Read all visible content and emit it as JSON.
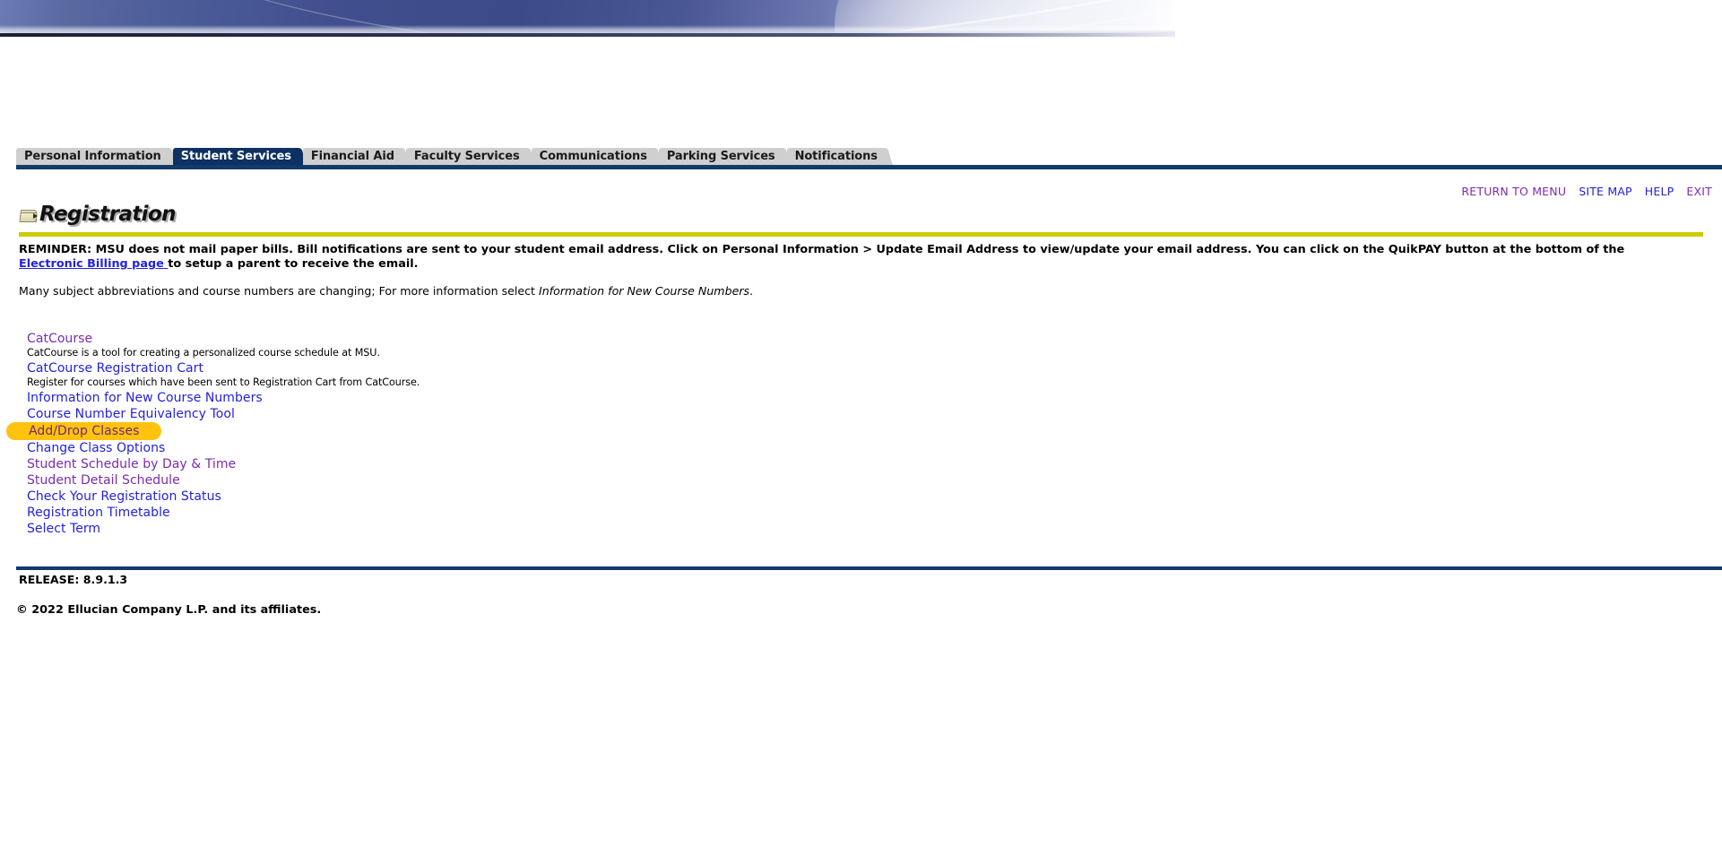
{
  "banner": {
    "alt": "university-banner-graphic"
  },
  "tabs": [
    {
      "label": "Personal Information",
      "active": false
    },
    {
      "label": "Student Services",
      "active": true
    },
    {
      "label": "Financial Aid",
      "active": false
    },
    {
      "label": "Faculty Services",
      "active": false
    },
    {
      "label": "Communications",
      "active": false
    },
    {
      "label": "Parking Services",
      "active": false
    },
    {
      "label": "Notifications",
      "active": false
    }
  ],
  "top_links": [
    {
      "label": "RETURN TO MENU",
      "state": "visited"
    },
    {
      "label": "SITE MAP",
      "state": "unvisited"
    },
    {
      "label": "HELP",
      "state": "unvisited"
    },
    {
      "label": "EXIT",
      "state": "visited"
    }
  ],
  "page": {
    "title": "Registration",
    "title_icon": "folder-icon"
  },
  "reminder": {
    "part1": "REMINDER: MSU does not mail paper bills. Bill notifications are sent to your student email address. Click on Personal Information > Update Email Address to view/update your email address. You can click on the QuikPAY button at the bottom of the ",
    "link": "Electronic Billing page ",
    "part2": "to setup a parent to receive the email."
  },
  "note": {
    "text_before": "Many subject abbreviations and course numbers are changing; For more information select ",
    "italic": "Information for New Course Numbers",
    "text_after": "."
  },
  "menu": {
    "items": [
      {
        "label": "CatCourse",
        "state": "visited",
        "desc": "CatCourse is a tool for creating a personalized course schedule at MSU.",
        "highlighted": false
      },
      {
        "label": "CatCourse Registration Cart",
        "state": "unvisited",
        "desc": "Register for courses which have been sent to Registration Cart from CatCourse.",
        "highlighted": false
      },
      {
        "label": "Information for New Course Numbers",
        "state": "unvisited",
        "desc": "",
        "highlighted": false
      },
      {
        "label": "Course Number Equivalency Tool",
        "state": "unvisited",
        "desc": "",
        "highlighted": false
      },
      {
        "label": "Add/Drop Classes",
        "state": "visited",
        "desc": "",
        "highlighted": true
      },
      {
        "label": "Change Class Options",
        "state": "unvisited",
        "desc": "",
        "highlighted": false
      },
      {
        "label": "Student Schedule by Day & Time",
        "state": "visited",
        "desc": "",
        "highlighted": false
      },
      {
        "label": "Student Detail Schedule",
        "state": "visited",
        "desc": "",
        "highlighted": false
      },
      {
        "label": "Check Your Registration Status",
        "state": "unvisited",
        "desc": "",
        "highlighted": false
      },
      {
        "label": "Registration Timetable",
        "state": "unvisited",
        "desc": "",
        "highlighted": false
      },
      {
        "label": "Select Term",
        "state": "unvisited",
        "desc": "",
        "highlighted": false
      }
    ]
  },
  "footer": {
    "release": "RELEASE: 8.9.1.3",
    "copyright": "© 2022 Ellucian Company L.P. and its affiliates."
  },
  "colors": {
    "accent_navy": "#123a6b",
    "active_tab": "#0d3162",
    "olive_rule": "#cccc00",
    "highlight_pill": "#ffc20e",
    "link_unvisited": "#2222dd",
    "link_visited": "#7b2bab"
  }
}
